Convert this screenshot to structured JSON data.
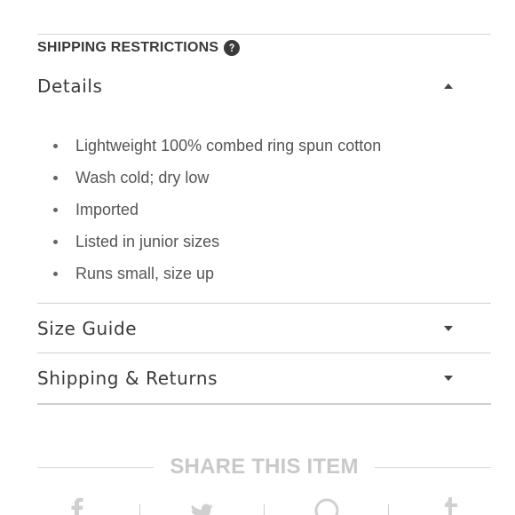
{
  "shipping_restrictions": {
    "label": "SHIPPING RESTRICTIONS",
    "icon": "question-circle-icon"
  },
  "sections": {
    "details": {
      "title": "Details",
      "expanded": true,
      "items": [
        "Lightweight 100% combed ring spun cotton",
        "Wash cold; dry low",
        "Imported",
        "Listed in junior sizes",
        "Runs small, size up"
      ]
    },
    "size_guide": {
      "title": "Size Guide",
      "expanded": false
    },
    "shipping_returns": {
      "title": "Shipping & Returns",
      "expanded": false
    }
  },
  "share": {
    "title": "SHARE THIS ITEM",
    "icons": [
      "facebook-icon",
      "twitter-icon",
      "pinterest-icon",
      "tumblr-icon"
    ]
  },
  "colors": {
    "text": "#333333",
    "muted": "#c9c9c9",
    "rule": "#d0d0d0"
  }
}
